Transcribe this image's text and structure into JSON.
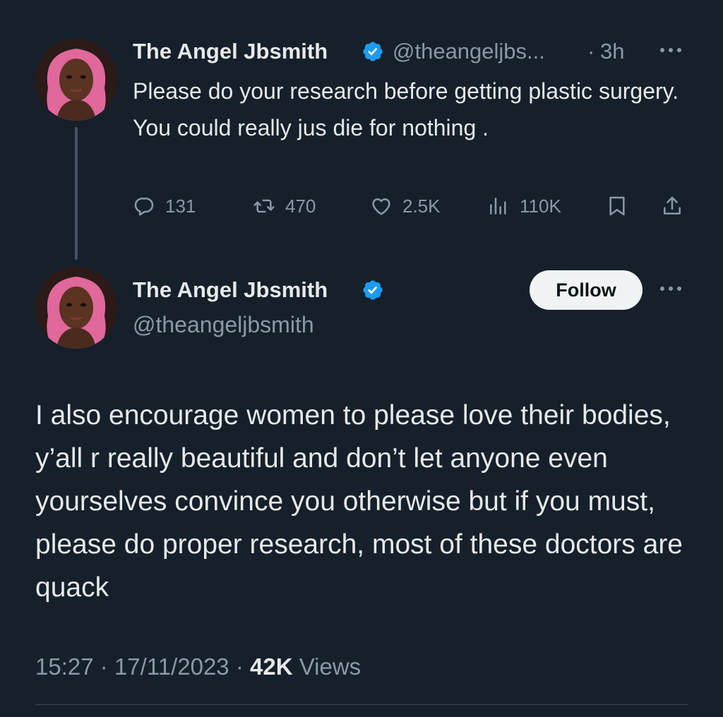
{
  "colors": {
    "background": "#15202b",
    "text": "#e7e9ea",
    "secondary_text": "#8b98a5",
    "verified_blue": "#1d9bf0",
    "thread_line": "#425466",
    "follow_button_bg": "#eff3f4"
  },
  "tweet1": {
    "author_name": "The Angel Jbsmith",
    "handle": "@theangeljbs...",
    "separator": "·",
    "time": "3h",
    "text": "Please do your research before getting plastic surgery. You could really jus die for nothing .",
    "more_icon": "more-icon",
    "actions": {
      "replies": "131",
      "retweets": "470",
      "likes": "2.5K",
      "views": "110K"
    }
  },
  "tweet2": {
    "author_name": "The Angel Jbsmith",
    "handle": "@theangeljbsmith",
    "follow_label": "Follow",
    "text": "I also encourage women to please love their bodies, y’all r really beautiful and don’t let anyone even yourselves convince you otherwise but if you must, please do proper research, most of these doctors are quack",
    "time": "15:27",
    "separator": "·",
    "date": "17/11/2023",
    "views_count": "42K",
    "views_label": "Views"
  }
}
